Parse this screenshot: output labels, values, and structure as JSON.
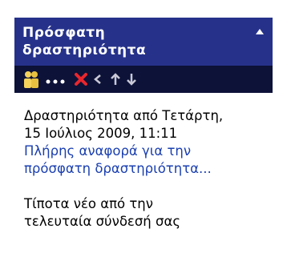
{
  "widget": {
    "title_line1": "Πρόσφατη",
    "title_line2": "δραστηριότητα",
    "collapse_icon": "collapse-up-icon",
    "colors": {
      "header": "#26328a",
      "toolbar": "#0c1238",
      "link": "#1a3fb0"
    },
    "toolbar_icons": [
      "users-icon",
      "ellipsis-icon",
      "cross-icon",
      "left-arrow-icon",
      "up-arrow-icon",
      "down-arrow-icon"
    ]
  },
  "activity": {
    "since_line1": "Δραστηριότητα από Τετάρτη,",
    "since_line2": "15 Ιούλιος 2009, 11:11",
    "report_link_line1": "Πλήρης αναφορά για την",
    "report_link_line2": "πρόσφατη δραστηριότητα...",
    "nothing_new_line1": "Τίποτα νέο από την",
    "nothing_new_line2": "τελευταία σύνδεσή σας"
  }
}
